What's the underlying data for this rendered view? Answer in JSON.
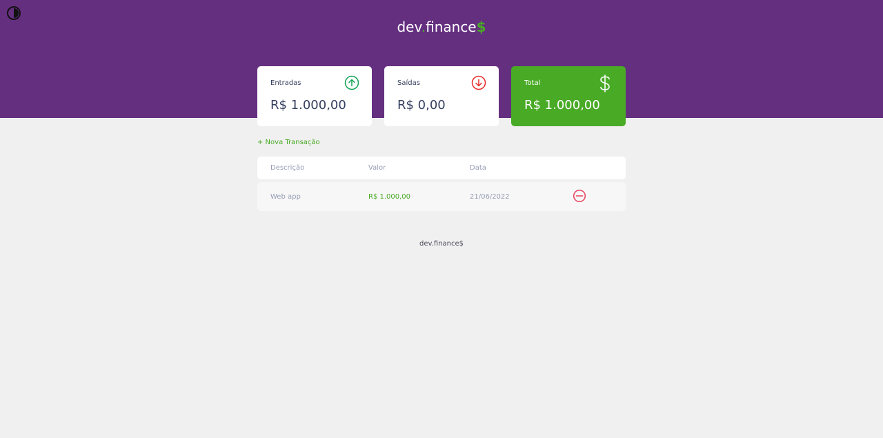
{
  "header": {
    "logo_prefix": "dev",
    "logo_dot": ".",
    "logo_name": "finance",
    "logo_symbol": "$",
    "theme_toggle_icon": "contrast-icon"
  },
  "cards": {
    "income": {
      "label": "Entradas",
      "value": "R$ 1.000,00",
      "icon": "arrow-up-circle-icon",
      "icon_color": "#12a454"
    },
    "expense": {
      "label": "Saídas",
      "value": "R$ 0,00",
      "icon": "arrow-down-circle-icon",
      "icon_color": "#e92929"
    },
    "total": {
      "label": "Total",
      "value": "R$ 1.000,00",
      "icon": "dollar-sign-icon",
      "background": "#49aa26"
    }
  },
  "actions": {
    "new_transaction": "+ Nova Transação"
  },
  "table": {
    "headers": [
      "Descrição",
      "Valor",
      "Data"
    ],
    "rows": [
      {
        "description": "Web app",
        "amount": "R$ 1.000,00",
        "date": "21/06/2022",
        "remove_icon": "minus-circle-icon"
      }
    ]
  },
  "footer": {
    "text": "dev.finance$"
  },
  "colors": {
    "header_bg": "#652f80",
    "accent_green": "#49aa26",
    "page_bg": "#f0f0f0"
  }
}
